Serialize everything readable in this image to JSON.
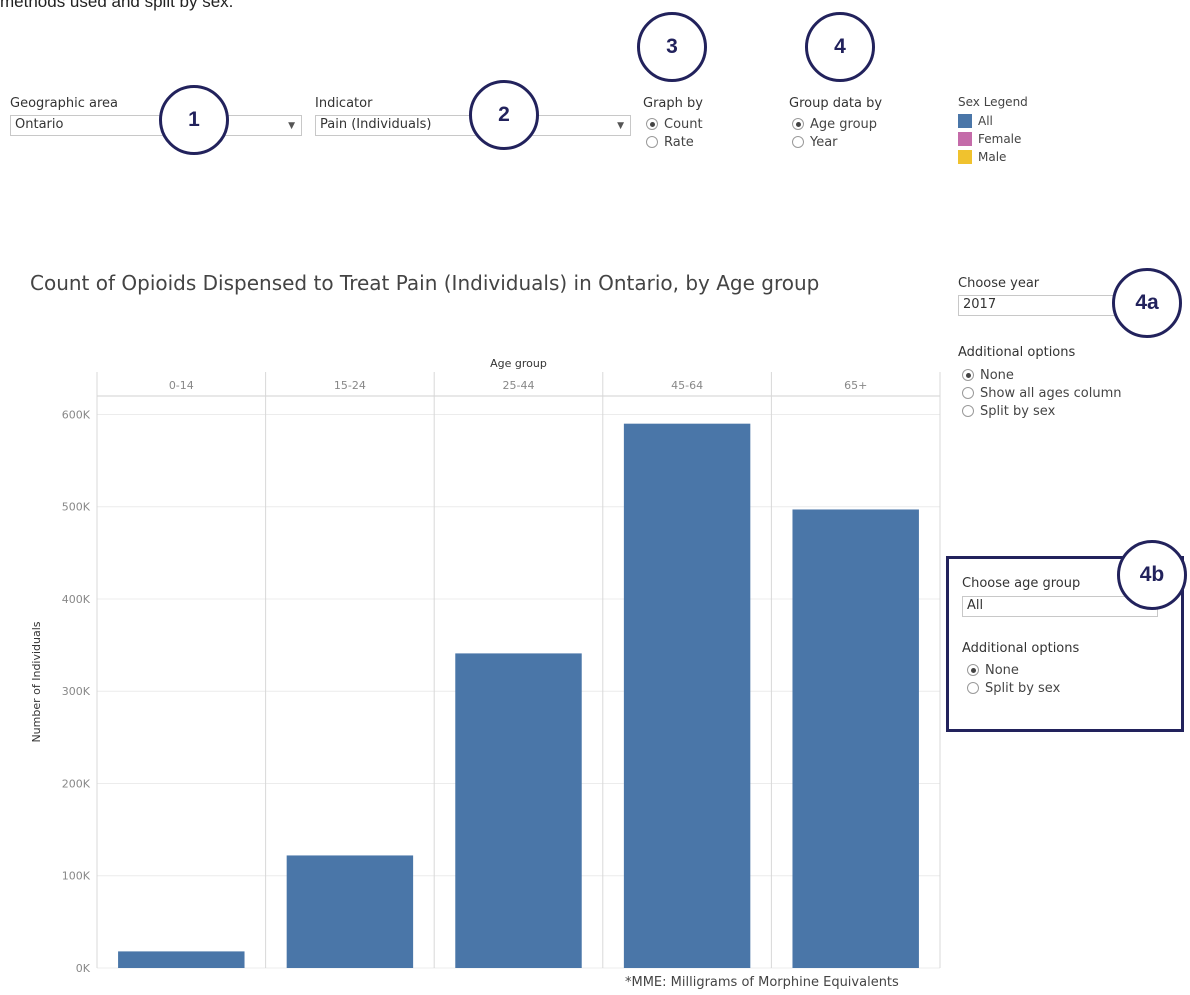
{
  "top_text": "methods used and split by sex.",
  "controls": {
    "geographic_area": {
      "label": "Geographic area",
      "value": "Ontario"
    },
    "indicator": {
      "label": "Indicator",
      "value": "Pain (Individuals)"
    },
    "graph_by": {
      "label": "Graph by",
      "options": [
        "Count",
        "Rate"
      ],
      "selected": "Count"
    },
    "group_data_by": {
      "label": "Group data by",
      "options": [
        "Age group",
        "Year"
      ],
      "selected": "Age group"
    },
    "sex_legend": {
      "title": "Sex Legend",
      "items": [
        {
          "label": "All",
          "color": "#4a76a8"
        },
        {
          "label": "Female",
          "color": "#c46ba9"
        },
        {
          "label": "Male",
          "color": "#f0c22e"
        }
      ]
    },
    "choose_year": {
      "label": "Choose year",
      "value": "2017"
    },
    "additional_options_year": {
      "label": "Additional options",
      "options": [
        "None",
        "Show all ages column",
        "Split by sex"
      ],
      "selected": "None"
    },
    "choose_age_group": {
      "label": "Choose age group",
      "value": "All"
    },
    "additional_options_age": {
      "label": "Additional options",
      "options": [
        "None",
        "Split by sex"
      ],
      "selected": "None"
    }
  },
  "callouts": [
    "1",
    "2",
    "3",
    "4",
    "4a",
    "4b"
  ],
  "footnote": "*MME: Milligrams of Morphine Equivalents",
  "chart_data": {
    "type": "bar",
    "title": "Count of Opioids Dispensed to Treat Pain (Individuals) in Ontario, by Age group",
    "xlabel": "Age group",
    "ylabel": "Number of Individuals",
    "categories": [
      "0-14",
      "15-24",
      "25-44",
      "45-64",
      "65+"
    ],
    "series": [
      {
        "values": [
          18000,
          122000,
          341000,
          590000,
          497000
        ]
      }
    ],
    "ylim": [
      0,
      620000
    ],
    "yticks": [
      0,
      100000,
      200000,
      300000,
      400000,
      500000,
      600000
    ],
    "ytick_labels": [
      "0K",
      "100K",
      "200K",
      "300K",
      "400K",
      "500K",
      "600K"
    ],
    "bar_color": "#4a76a8",
    "grid": true
  }
}
